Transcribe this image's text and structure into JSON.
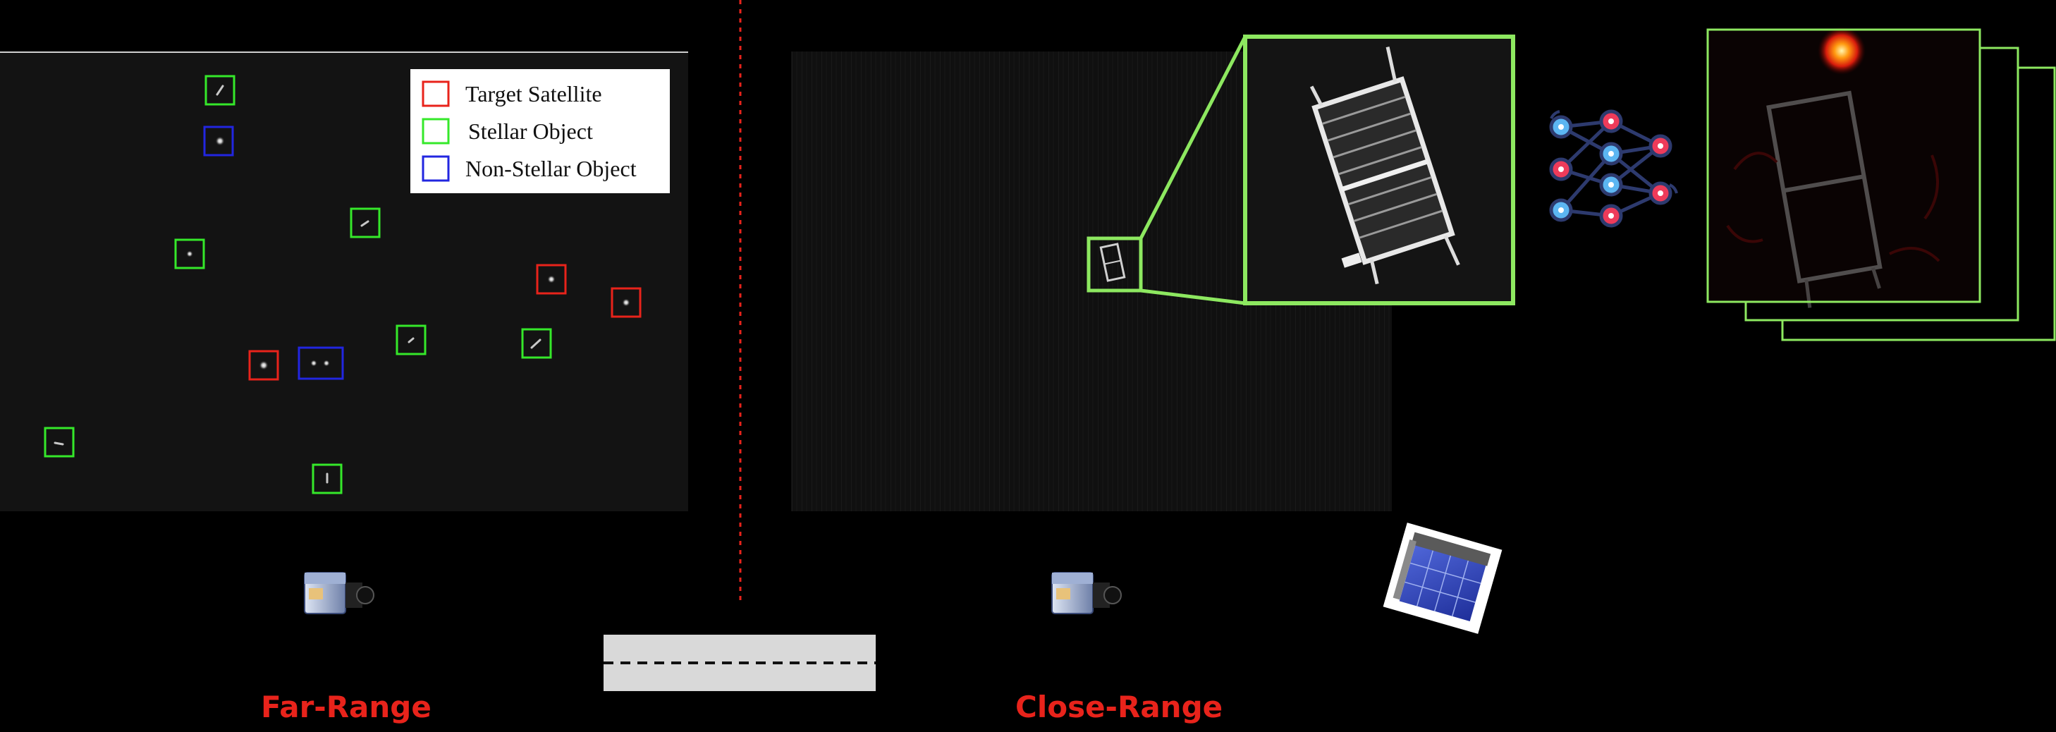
{
  "legend": {
    "items": [
      {
        "label": "Target Satellite",
        "color": "#e8231b"
      },
      {
        "label": "Stellar Object",
        "color": "#35e82a"
      },
      {
        "label": "Non-Stellar Object",
        "color": "#2226e0"
      }
    ]
  },
  "labels": {
    "far_range": "Far-Range",
    "close_range": "Close-Range"
  },
  "colors": {
    "background": "#000000",
    "label_red": "#e8231b",
    "zoom_green": "#8de860",
    "divider_red": "#e8231b"
  },
  "icons": {
    "far_camera": "camera-icon",
    "close_camera": "camera-icon",
    "neural_net": "neural-network-icon",
    "satellite": "satellite-icon"
  }
}
